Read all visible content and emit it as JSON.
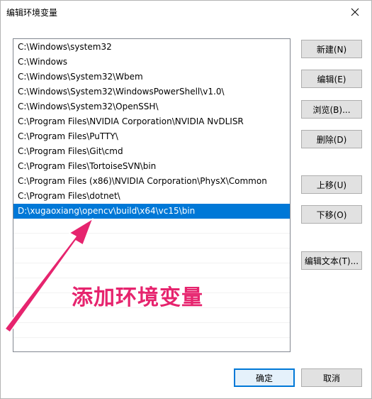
{
  "window": {
    "title": "编辑环境变量"
  },
  "path_list": {
    "items": [
      "C:\\Windows\\system32",
      "C:\\Windows",
      "C:\\Windows\\System32\\Wbem",
      "C:\\Windows\\System32\\WindowsPowerShell\\v1.0\\",
      "C:\\Windows\\System32\\OpenSSH\\",
      "C:\\Program Files\\NVIDIA Corporation\\NVIDIA NvDLISR",
      "C:\\Program Files\\PuTTY\\",
      "C:\\Program Files\\Git\\cmd",
      "C:\\Program Files\\TortoiseSVN\\bin",
      "C:\\Program Files (x86)\\NVIDIA Corporation\\PhysX\\Common",
      "C:\\Program Files\\dotnet\\",
      "D:\\xugaoxiang\\opencv\\build\\x64\\vc15\\bin"
    ],
    "selected_index": 11,
    "selection_color": "#0078d7"
  },
  "buttons": {
    "new": "新建(N)",
    "edit": "编辑(E)",
    "browse": "浏览(B)...",
    "delete": "删除(D)",
    "move_up": "上移(U)",
    "move_down": "下移(O)",
    "edit_text": "编辑文本(T)...",
    "ok": "确定",
    "cancel": "取消"
  },
  "annotation": {
    "text": "添加环境变量",
    "color": "#e6246e",
    "icon": "arrow-icon"
  }
}
